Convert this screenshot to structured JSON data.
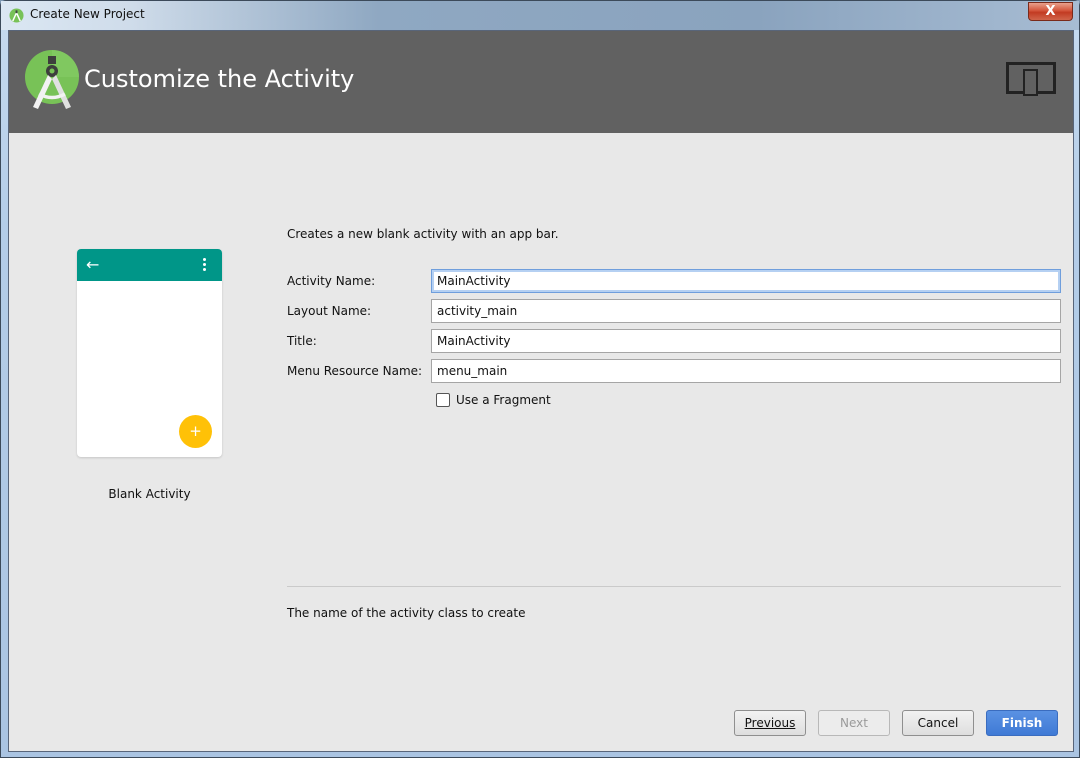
{
  "window": {
    "title": "Create New Project",
    "close_label": "X"
  },
  "header": {
    "title": "Customize the Activity",
    "logo_icon": "android-studio-logo-icon",
    "form_factor_icon": "tablet-phone-icon"
  },
  "preview": {
    "template_label": "Blank Activity",
    "appbar_color": "#009688",
    "fab_color": "#FFC107",
    "back_icon": "←",
    "fab_icon": "+"
  },
  "form": {
    "description": "Creates a new blank activity with an app bar.",
    "fields": [
      {
        "label": "Activity Name:",
        "value": "MainActivity",
        "focused": true
      },
      {
        "label": "Layout Name:",
        "value": "activity_main",
        "focused": false
      },
      {
        "label": "Title:",
        "value": "MainActivity",
        "focused": false
      },
      {
        "label": "Menu Resource Name:",
        "value": "menu_main",
        "focused": false
      }
    ],
    "checkbox": {
      "label": "Use a Fragment",
      "checked": false
    },
    "help_text": "The name of the activity class to create"
  },
  "buttons": {
    "previous_label": "Previous",
    "next_label": "Next",
    "cancel_label": "Cancel",
    "finish_label": "Finish",
    "finish_color": "#4A86DA"
  }
}
